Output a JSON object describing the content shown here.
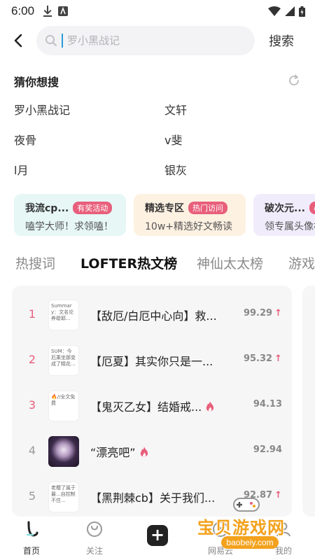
{
  "status_bar": {
    "time": "6:00"
  },
  "search": {
    "back_icon": "back-arrow-icon",
    "placeholder": "罗小黑战记",
    "submit_label": "搜索"
  },
  "guess": {
    "title": "猜你想搜",
    "items": [
      "罗小黑战记",
      "文轩",
      "夜骨",
      "v斐",
      "l月",
      "银灰"
    ]
  },
  "promos": [
    {
      "title": "我流cp...",
      "badge": "有奖活动",
      "subtitle": "嗑学大师！求领嗑！",
      "bg": "#e6f7f6",
      "badge_color": "#e85f7b"
    },
    {
      "title": "精选专区",
      "badge": "热门访问",
      "subtitle": "10w+精选好文畅读",
      "bg": "#fdf1e2",
      "badge_color": "#e85f7b"
    },
    {
      "title": "破次元...",
      "badge": "心",
      "subtitle": "领专属头像框",
      "bg": "#f1ecfb",
      "badge_color": "#e85f7b"
    }
  ],
  "rank_tabs": [
    "热搜词",
    "LOFTER热文榜",
    "神仙太太榜",
    "游戏"
  ],
  "rank_list": [
    {
      "rank": "1",
      "thumb_text": "Summary：文名论养歇耶...",
      "title": "【敌厄/白厄中心向】救...",
      "score": "99.29",
      "trend": "up",
      "hot": false
    },
    {
      "rank": "2",
      "thumb_text": "SUM：今厄乘坐那变成了精花...",
      "title": "【厄夏】其实你只是一...",
      "score": "95.32",
      "trend": "up",
      "hot": false
    },
    {
      "rank": "3",
      "thumb_text": "🔥//全文免费",
      "title": "【鬼灭乙女】结婚戒...",
      "score": "94.13",
      "trend": "",
      "hot": true
    },
    {
      "rank": "4",
      "thumb_text": "",
      "title": "“漂亮吧”",
      "score": "92.94",
      "trend": "",
      "hot": true
    },
    {
      "rank": "5",
      "thumb_text": "老樱了属于最...自控制不住...",
      "title": "【黑荆棘cb】关于我们...",
      "score": "92.87",
      "trend": "up",
      "hot": false
    }
  ],
  "bottom_nav": [
    {
      "label": "首页",
      "icon": "home-icon",
      "active": true
    },
    {
      "label": "关注",
      "icon": "follow-icon",
      "active": false
    },
    {
      "label": "",
      "icon": "plus-icon",
      "active": false
    },
    {
      "label": "网易云",
      "icon": "music-icon",
      "active": false
    },
    {
      "label": "我的",
      "icon": "profile-icon",
      "active": false
    }
  ],
  "watermark": {
    "text": "宝贝游戏网",
    "url": "baobeiy.com"
  },
  "colors": {
    "accent_pink": "#e85f7b",
    "caret_blue": "#2a9bd8",
    "watermark_orange": "#f3a21d"
  }
}
